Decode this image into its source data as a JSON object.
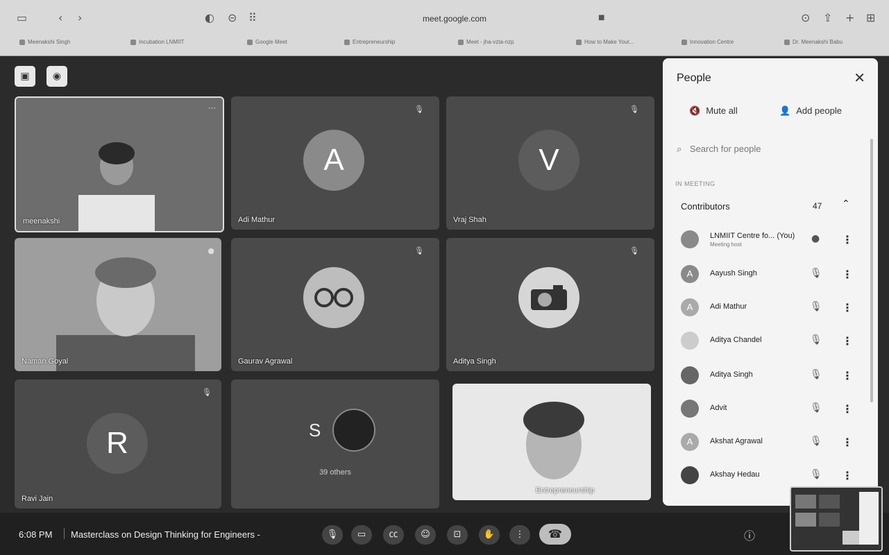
{
  "browser": {
    "url": "meet.google.com",
    "bookmarks": [
      "Meenakshi Singh",
      "Incubation LNMIIT",
      "Google Meet",
      "Entrepreneurship",
      "Meet - jha-vzta-nzp",
      "How to Make Your...",
      "Innovation Centre",
      "Dr. Meenakshi Babu"
    ]
  },
  "tiles": [
    {
      "name": "meenakshi",
      "letter": "",
      "kind": "video-woman"
    },
    {
      "name": "Adi Mathur",
      "letter": "A",
      "kind": "avatar"
    },
    {
      "name": "Vraj Shah",
      "letter": "V",
      "kind": "avatar"
    },
    {
      "name": "Naman Goyal",
      "letter": "",
      "kind": "video-man"
    },
    {
      "name": "Gaurav Agrawal",
      "letter": "",
      "kind": "image-glasses"
    },
    {
      "name": "Aditya Singh",
      "letter": "",
      "kind": "image-camera"
    },
    {
      "name": "Ravi Jain",
      "letter": "R",
      "kind": "avatar"
    },
    {
      "name": "39 others",
      "letter": "S",
      "kind": "others"
    },
    {
      "name": "Entrepreneurship",
      "letter": "",
      "kind": "video-woman2"
    }
  ],
  "panel": {
    "title": "People",
    "mute_all": "Mute all",
    "add_people": "Add people",
    "search_placeholder": "Search for people",
    "section": "IN MEETING",
    "group_label": "Contributors",
    "group_count": "47",
    "people": [
      {
        "name": "LNMIIT Centre fo... (You)",
        "sub": "Meeting host",
        "initial": ""
      },
      {
        "name": "Aayush Singh",
        "sub": "",
        "initial": "A"
      },
      {
        "name": "Adi Mathur",
        "sub": "",
        "initial": "A"
      },
      {
        "name": "Aditya Chandel",
        "sub": "",
        "initial": ""
      },
      {
        "name": "Aditya Singh",
        "sub": "",
        "initial": ""
      },
      {
        "name": "Advit",
        "sub": "",
        "initial": ""
      },
      {
        "name": "Akshat Agrawal",
        "sub": "",
        "initial": "A"
      },
      {
        "name": "Akshay Hedau",
        "sub": "",
        "initial": ""
      }
    ]
  },
  "bottom": {
    "time": "6:08 PM",
    "meeting_title": "Masterclass on Design Thinking for Engineers -"
  },
  "icons": [
    "sidebar-icon",
    "back-icon",
    "forward-icon",
    "shield-icon",
    "record-icon",
    "mic-icon",
    "camera-icon",
    "captions-icon",
    "emoji-icon",
    "present-icon",
    "hand-icon",
    "more-icon",
    "hangup-icon",
    "info-icon",
    "close-icon",
    "mute-icon",
    "add-person-icon",
    "search-icon",
    "chevron-up-icon"
  ]
}
